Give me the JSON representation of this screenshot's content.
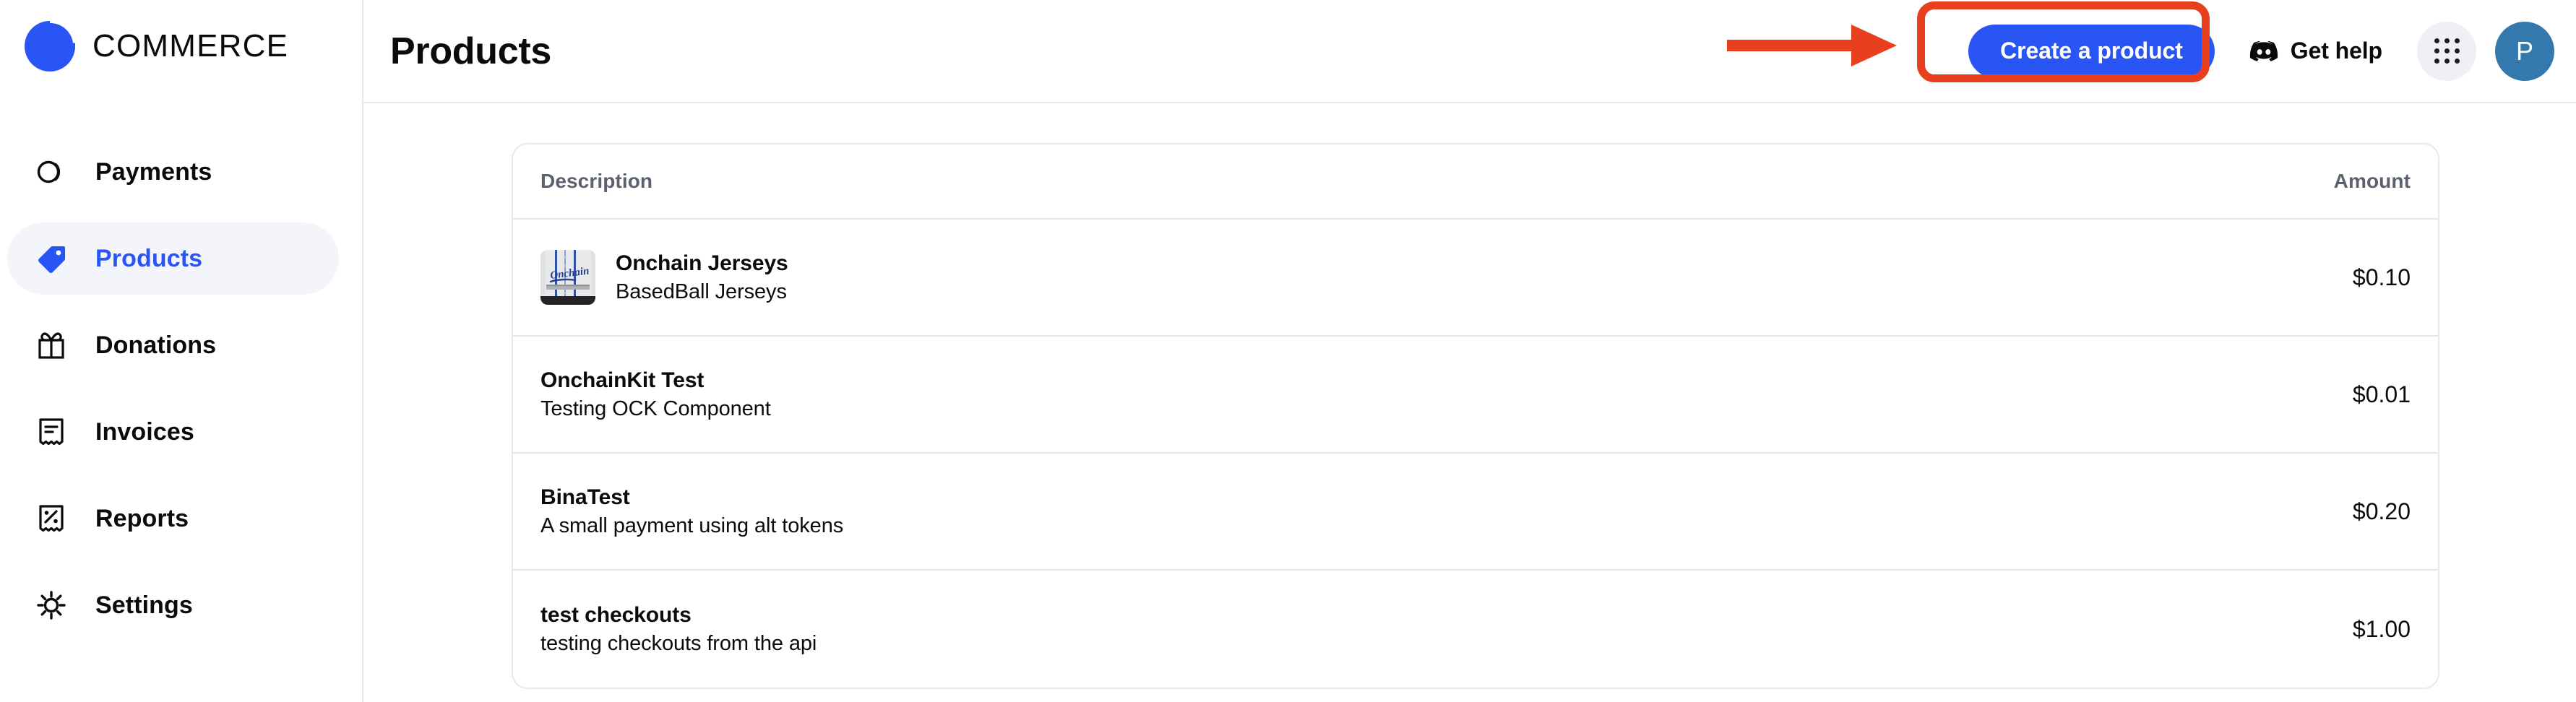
{
  "brand": {
    "name": "COMMERCE",
    "logo_color": "#2a55f5",
    "logo_icon": "coinbase-commerce-logo"
  },
  "sidebar": {
    "items": [
      {
        "label": "Payments",
        "icon": "payments-icon",
        "active": false
      },
      {
        "label": "Products",
        "icon": "tag-icon",
        "active": true
      },
      {
        "label": "Donations",
        "icon": "gift-icon",
        "active": false
      },
      {
        "label": "Invoices",
        "icon": "receipt-icon",
        "active": false
      },
      {
        "label": "Reports",
        "icon": "report-percent-icon",
        "active": false
      },
      {
        "label": "Settings",
        "icon": "gear-icon",
        "active": false
      }
    ],
    "active_color": "#2a55f5",
    "active_pill_bg": "#f3f5fa"
  },
  "header": {
    "title": "Products",
    "create_button_label": "Create a product",
    "create_button_color": "#2a55f5",
    "get_help_label": "Get help",
    "get_help_icon": "discord-icon",
    "apps_icon": "grid-dots-icon",
    "avatar_initial": "P",
    "avatar_color": "#3479ad"
  },
  "table": {
    "columns": [
      "Description",
      "Amount"
    ],
    "rows": [
      {
        "name": "Onchain Jerseys",
        "description": "BasedBall Jerseys",
        "amount": "$0.10",
        "thumbnail": "baseball-jersey-photo"
      },
      {
        "name": "OnchainKit Test",
        "description": "Testing OCK Component",
        "amount": "$0.01",
        "thumbnail": null
      },
      {
        "name": "BinaTest",
        "description": "A small payment using alt tokens",
        "amount": "$0.20",
        "thumbnail": null
      },
      {
        "name": "test checkouts",
        "description": "testing checkouts from the api",
        "amount": "$1.00",
        "thumbnail": null
      }
    ]
  },
  "annotations": {
    "highlight_color": "#e8401f",
    "highlight_target": "create-product-button",
    "arrow_direction": "right"
  }
}
